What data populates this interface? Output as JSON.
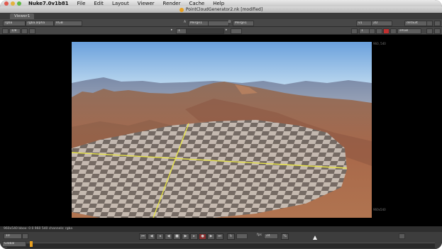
{
  "menubar": {
    "app_name": "Nuke7.0v1b81",
    "items": [
      "File",
      "Edit",
      "Layout",
      "Viewer",
      "Render",
      "Cache",
      "Help"
    ]
  },
  "window": {
    "title": "PointCloudGenerator2.nk [modified]"
  },
  "tabs": [
    {
      "label": "Viewer1"
    }
  ],
  "toolbar1": {
    "channel_set": "rgba",
    "channel_layer": "rgba.alpha",
    "display_channel": "RGB",
    "a_label": "A",
    "a_input": "Merge1",
    "b_label": "B",
    "b_input": "Merge1",
    "view_select": "v1",
    "view_mode": "2D",
    "lut": "default"
  },
  "toolbar2": {
    "downrez": "1/8",
    "gain": "1",
    "frame": "1",
    "display_lut": "sRGB"
  },
  "viewer": {
    "format_top_right": "960, 540",
    "format_bottom_right": "960x540"
  },
  "status": {
    "text": "960x540 bbox: 0 0 960 540 channels: rgba"
  },
  "timeline": {
    "frame_current": "10",
    "fps_label": "fps",
    "fps_value": "24",
    "range_mode": "Global",
    "increment": "10"
  },
  "colors": {
    "checker_light": "#c8c2bb",
    "checker_dark": "#6f6a66",
    "grid_line": "#e6e24a",
    "record_button": "#e04040",
    "sky_top": "#6aa0dc"
  }
}
